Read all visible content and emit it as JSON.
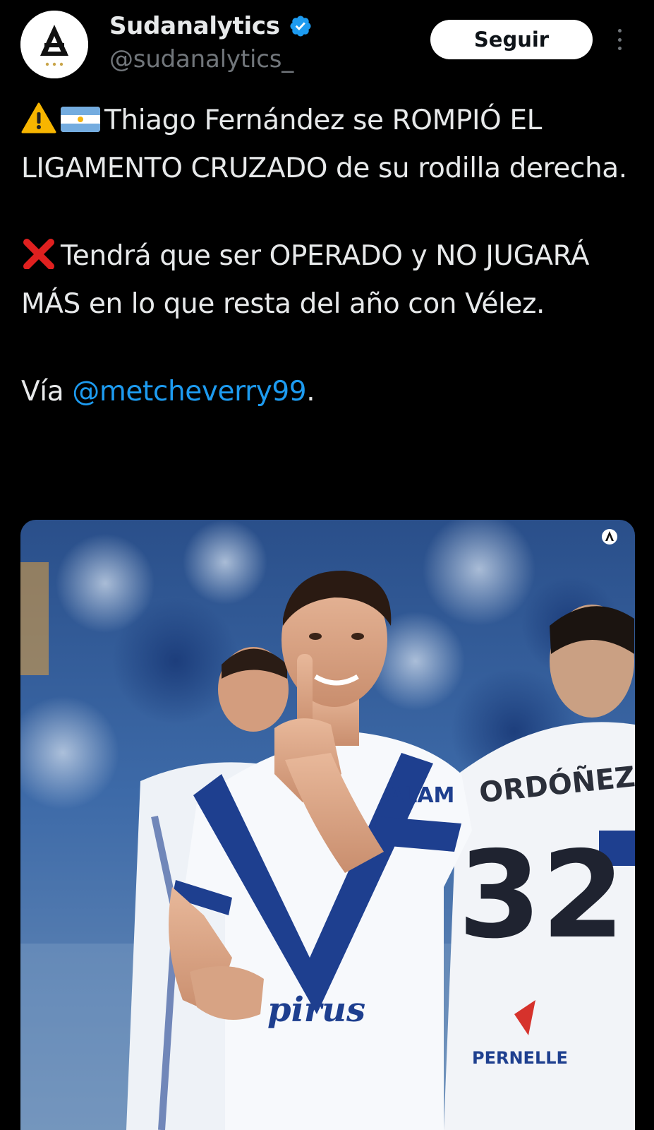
{
  "account": {
    "display_name": "Sudanalytics",
    "handle": "@sudanalytics_",
    "verified": true,
    "avatar_icon": "sudanalytics-logo-icon"
  },
  "actions": {
    "follow_label": "Seguir",
    "more_icon": "more-vertical-icon"
  },
  "tweet": {
    "line1_text": "Thiago Fernández se ROMPIÓ EL LIGAMENTO CRUZADO de su rodilla derecha.",
    "line1_emojis": [
      "warning-emoji",
      "argentina-flag-emoji"
    ],
    "line2_text": "Tendrá que ser OPERADO y NO JUGARÁ MÁS en lo que resta del año con Vélez.",
    "line2_emoji": "cross-mark-emoji",
    "via_prefix": "Vía ",
    "via_mention": "@metcheverry99",
    "via_suffix": "."
  },
  "media": {
    "jersey_sponsor": "ALAM",
    "jersey_front_text": "pirus",
    "teammate_name": "ORDÓÑEZ",
    "teammate_number": "32",
    "sleeve_text": "PERNELLE"
  },
  "colors": {
    "background": "#000000",
    "text": "#e7e9ea",
    "secondary": "#71767b",
    "link": "#1d9bf0",
    "verified": "#1d9bf0",
    "velez_blue": "#1e3f8f"
  }
}
